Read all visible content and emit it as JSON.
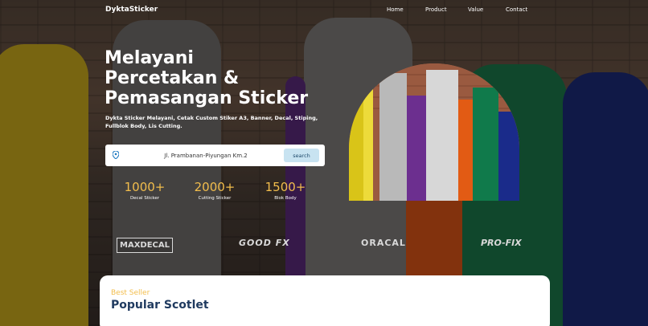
{
  "brand": "DyktaSticker",
  "nav": [
    "Home",
    "Product",
    "Value",
    "Contact"
  ],
  "hero": {
    "title_lines": [
      "Melayani",
      "Percetakan &",
      "Pemasangan Sticker"
    ],
    "subtitle": "Dykta Sticker Melayani, Cetak Custom Stiker A3, Banner, Decal, Stiping, Fullblok Body, Lis Cutting."
  },
  "search": {
    "value": "Jl. Prambanan-Piyungan Km.2",
    "button": "search"
  },
  "stats": [
    {
      "value": "1000+",
      "label": "Decal Sticker"
    },
    {
      "value": "2000+",
      "label": "Cutting Sticker"
    },
    {
      "value": "1500+",
      "label": "Blok Body"
    }
  ],
  "partner_logos": [
    "MAXDECAL",
    "GOOD FX",
    "ORACAL",
    "PRO-FIX"
  ],
  "section": {
    "kicker": "Best Seller",
    "title": "Popular Scotlet"
  },
  "colors": {
    "accent_gold": "#f2bd4c",
    "title_navy": "#1f3a5f",
    "search_button_bg": "#c8e3f1"
  },
  "icons": {
    "search_pin": "location-pin-icon"
  }
}
